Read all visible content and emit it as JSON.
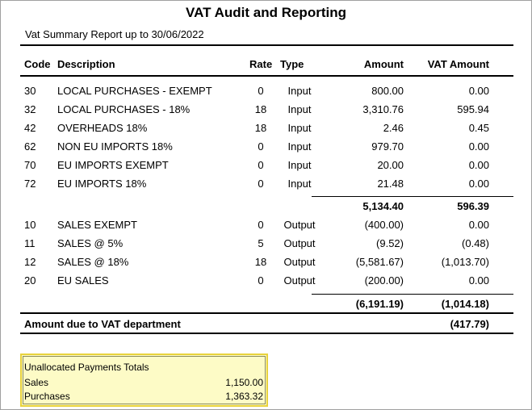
{
  "report": {
    "title": "VAT Audit and Reporting",
    "subtitle": "Vat Summary Report up to 30/06/2022"
  },
  "columns": {
    "code": "Code",
    "description": "Description",
    "rate": "Rate",
    "type": "Type",
    "amount": "Amount",
    "vat_amount": "VAT Amount"
  },
  "input_rows": [
    {
      "code": "30",
      "description": "LOCAL PURCHASES - EXEMPT",
      "rate": "0",
      "type": "Input",
      "amount": "800.00",
      "vat": "0.00"
    },
    {
      "code": "32",
      "description": "LOCAL PURCHASES - 18%",
      "rate": "18",
      "type": "Input",
      "amount": "3,310.76",
      "vat": "595.94"
    },
    {
      "code": "42",
      "description": "OVERHEADS 18%",
      "rate": "18",
      "type": "Input",
      "amount": "2.46",
      "vat": "0.45"
    },
    {
      "code": "62",
      "description": "NON EU IMPORTS 18%",
      "rate": "0",
      "type": "Input",
      "amount": "979.70",
      "vat": "0.00"
    },
    {
      "code": "70",
      "description": "EU IMPORTS EXEMPT",
      "rate": "0",
      "type": "Input",
      "amount": "20.00",
      "vat": "0.00"
    },
    {
      "code": "72",
      "description": "EU IMPORTS 18%",
      "rate": "0",
      "type": "Input",
      "amount": "21.48",
      "vat": "0.00"
    }
  ],
  "input_totals": {
    "amount": "5,134.40",
    "vat": "596.39"
  },
  "output_rows": [
    {
      "code": "10",
      "description": "SALES EXEMPT",
      "rate": "0",
      "type": "Output",
      "amount": "(400.00)",
      "vat": "0.00"
    },
    {
      "code": "11",
      "description": "SALES @ 5%",
      "rate": "5",
      "type": "Output",
      "amount": "(9.52)",
      "vat": "(0.48)"
    },
    {
      "code": "12",
      "description": "SALES @ 18%",
      "rate": "18",
      "type": "Output",
      "amount": "(5,581.67)",
      "vat": "(1,013.70)"
    },
    {
      "code": "20",
      "description": "EU SALES",
      "rate": "0",
      "type": "Output",
      "amount": "(200.00)",
      "vat": "0.00"
    }
  ],
  "output_totals": {
    "amount": "(6,191.19)",
    "vat": "(1,014.18)"
  },
  "amount_due": {
    "label": "Amount due to VAT department",
    "value": "(417.79)"
  },
  "unallocated": {
    "title": "Unallocated Payments Totals",
    "rows": [
      {
        "label": "Sales",
        "value": "1,150.00"
      },
      {
        "label": "Purchases",
        "value": "1,363.32"
      }
    ]
  }
}
